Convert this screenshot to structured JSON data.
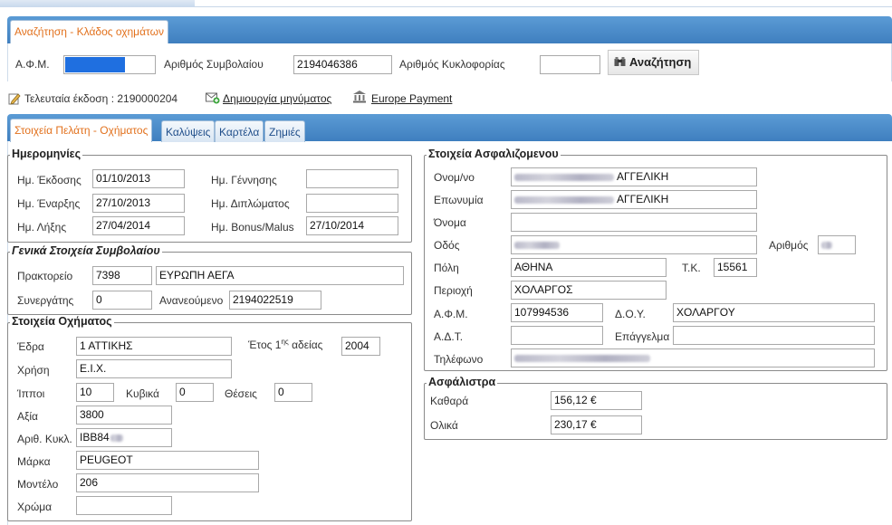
{
  "search_panel": {
    "tab_label": "Αναζήτηση - Κλάδος οχημάτων",
    "afm_label": "Α.Φ.Μ.",
    "contract_label": "Αριθμός Συμβολαίου",
    "contract_value": "2194046386",
    "plate_label": "Αριθμός Κυκλοφορίας",
    "plate_value": "",
    "search_button": "Αναζήτηση"
  },
  "toolbar": {
    "last_issue": "Τελευταία έκδοση : 2190000204",
    "create_message": "Δημιουργία μηνύματος",
    "europe_payment": "Europe Payment"
  },
  "tabs": [
    "Στοιχεία Πελάτη - Οχήματος",
    "Καλύψεις",
    "Καρτέλα",
    "Ζημιές"
  ],
  "dates": {
    "legend": "Ημερομηνίες",
    "issue_label": "Ημ. Έκδοσης",
    "issue_value": "01/10/2013",
    "start_label": "Ημ. Έναρξης",
    "start_value": "27/10/2013",
    "end_label": "Ημ. Λήξης",
    "end_value": "27/04/2014",
    "birth_label": "Ημ. Γέννησης",
    "birth_value": "",
    "license_label": "Ημ. Διπλώματος",
    "license_value": "",
    "bonus_label": "Ημ. Bonus/Malus",
    "bonus_value": "27/10/2014"
  },
  "contract": {
    "legend": "Γενικά Στοιχεία Συμβολαίου",
    "office_label": "Πρακτορείο",
    "office_code": "7398",
    "office_name": "ΕΥΡΩΠΗ ΑΕΓΑ",
    "partner_label": "Συνεργάτης",
    "partner_value": "0",
    "renewed_label": "Ανανεούμενο",
    "renewed_value": "2194022519"
  },
  "vehicle": {
    "legend": "Στοιχεία Οχήματος",
    "seat_label": "Έδρα",
    "seat_value": "1 ΑΤΤΙΚΗΣ",
    "year_label_pre": "Έτος 1",
    "year_label_sup": "ης",
    "year_label_post": " αδείας",
    "year_value": "2004",
    "use_label": "Χρήση",
    "use_value": "Ε.Ι.Χ.",
    "hp_label": "Ίπποι",
    "hp_value": "10",
    "cc_label": "Κυβικά",
    "cc_value": "0",
    "seats_label": "Θέσεις",
    "seats_value": "0",
    "value_label": "Αξία",
    "value_value": "3800",
    "plate_label": "Αριθ. Κυκλ.",
    "plate_value": "IBB84",
    "make_label": "Μάρκα",
    "make_value": "PEUGEOT",
    "model_label": "Μοντέλο",
    "model_value": "206",
    "color_label": "Χρώμα",
    "color_value": ""
  },
  "insured": {
    "legend": "Στοιχεία Ασφαλιζομενου",
    "fullname_label": "Ονομ/νο",
    "fullname_value": "ΑΓΓΕΛΙΚΗ",
    "surname_label": "Επωνυμία",
    "surname_value": "ΑΓΓΕΛΙΚΗ",
    "name_label": "Όνομα",
    "name_value": "",
    "street_label": "Οδός",
    "number_label": "Αριθμός",
    "city_label": "Πόλη",
    "city_value": "ΑΘΗΝΑ",
    "zip_label": "Τ.Κ.",
    "zip_value": "15561",
    "area_label": "Περιοχή",
    "area_value": "ΧΟΛΑΡΓΟΣ",
    "afm_label": "Α.Φ.Μ.",
    "afm_value": "107994536",
    "doy_label": "Δ.Ο.Υ.",
    "doy_value": "ΧΟΛΑΡΓΟΥ",
    "adt_label": "Α.Δ.Τ.",
    "adt_value": "",
    "job_label": "Επάγγελμα",
    "job_value": "",
    "phone_label": "Τηλέφωνο"
  },
  "premiums": {
    "legend": "Ασφάλιστρα",
    "net_label": "Καθαρά",
    "net_value": "156,12 €",
    "total_label": "Ολικά",
    "total_value": "230,17 €"
  },
  "colors": {
    "accent_orange": "#e2711d",
    "header_blue": "#4a8ccc",
    "selection_blue": "#1f6fe0"
  }
}
